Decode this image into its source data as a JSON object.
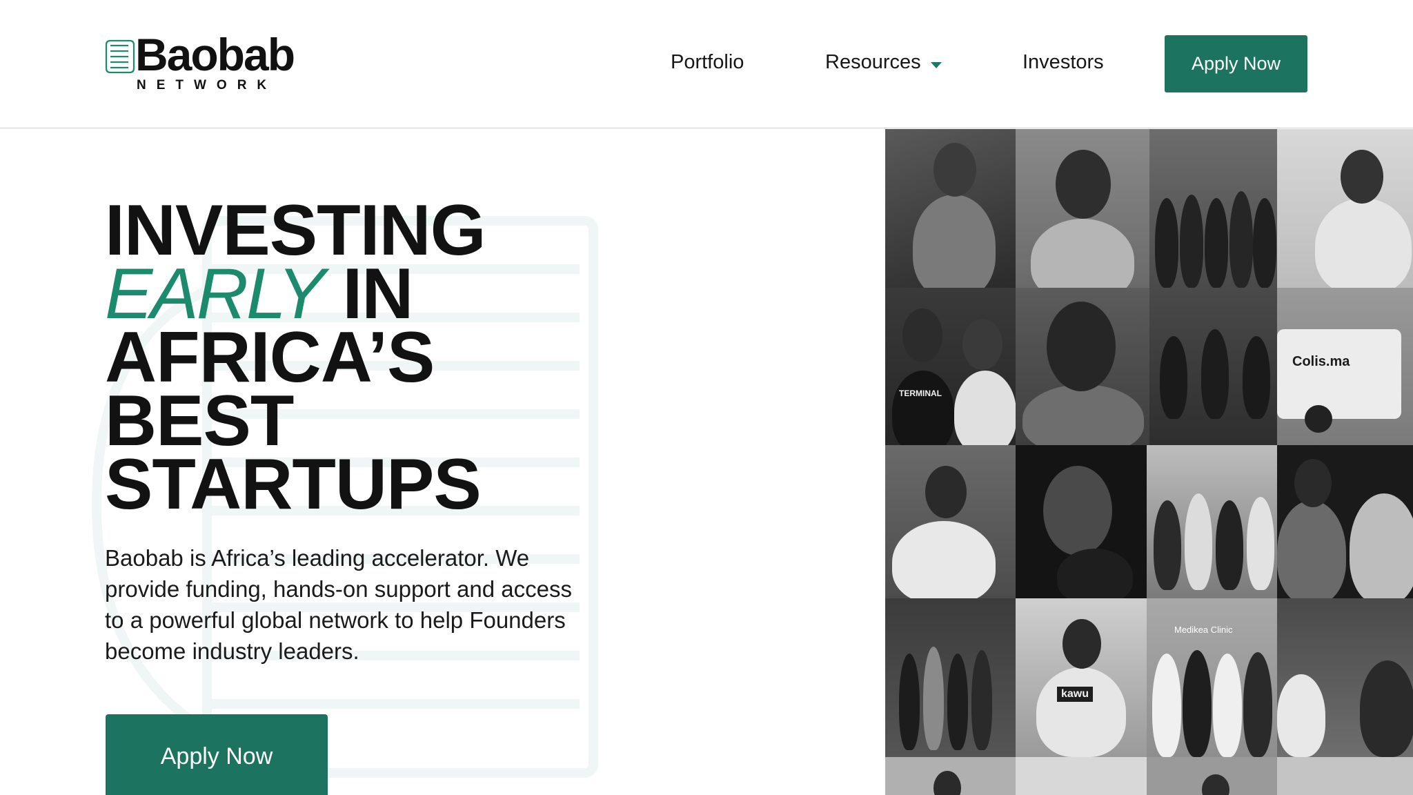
{
  "brand": {
    "name": "Baobab",
    "sub": "NETWORK",
    "accent_color": "#1c7460",
    "headline_accent_color": "#1c8a6c"
  },
  "nav": {
    "items": [
      {
        "label": "Portfolio"
      },
      {
        "label": "Resources",
        "has_dropdown": true
      },
      {
        "label": "Investors"
      }
    ],
    "cta_label": "Apply Now"
  },
  "hero": {
    "headline": {
      "line1": "INVESTING",
      "line2_accent": "EARLY",
      "line2_rest": " IN",
      "line3": "AFRICA’S",
      "line4": "BEST",
      "line5": "STARTUPS"
    },
    "lead": "Baobab is Africa’s leading accelerator. We provide funding, hands-on support and access to a powerful global network to help Founders become industry leaders.",
    "cta_label": "Apply Now"
  },
  "photo_grid": {
    "captions": [
      "Colis.ma",
      "TERMINAL",
      "kawu",
      "Medikea Clinic"
    ],
    "icons": [
      "caret-down-icon",
      "logo-mark-icon"
    ]
  }
}
